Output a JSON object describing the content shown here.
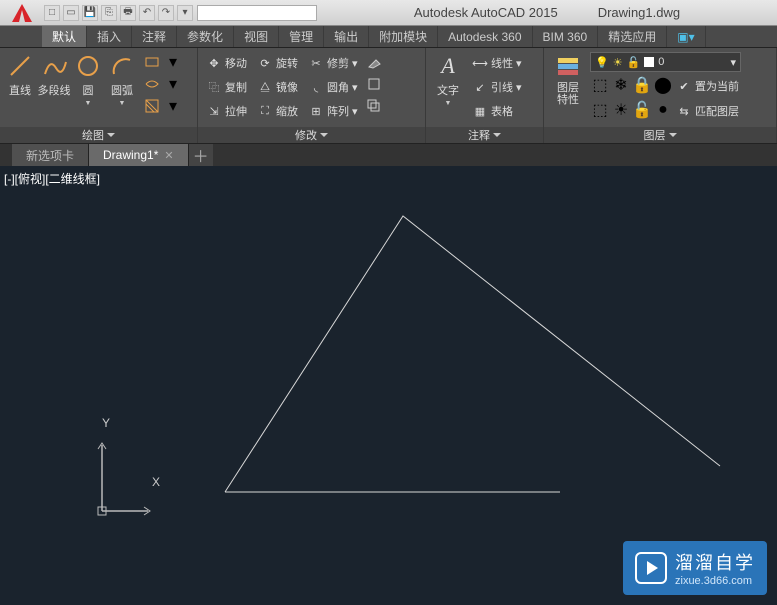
{
  "app": {
    "name": "Autodesk AutoCAD 2015",
    "doc": "Drawing1.dwg"
  },
  "qat": [
    "new",
    "open",
    "save",
    "undo",
    "redo",
    "print",
    "plot"
  ],
  "menutabs": [
    {
      "label": "默认",
      "active": true
    },
    {
      "label": "插入"
    },
    {
      "label": "注释"
    },
    {
      "label": "参数化"
    },
    {
      "label": "视图"
    },
    {
      "label": "管理"
    },
    {
      "label": "输出"
    },
    {
      "label": "附加模块"
    },
    {
      "label": "Autodesk 360"
    },
    {
      "label": "BIM 360"
    },
    {
      "label": "精选应用"
    }
  ],
  "panels": {
    "draw": {
      "title": "绘图",
      "big": [
        {
          "name": "line",
          "label": "直线"
        },
        {
          "name": "polyline",
          "label": "多段线"
        },
        {
          "name": "circle",
          "label": "圆"
        },
        {
          "name": "arc",
          "label": "圆弧"
        }
      ]
    },
    "modify": {
      "title": "修改",
      "rows": [
        [
          {
            "name": "move",
            "label": "移动"
          },
          {
            "name": "rotate",
            "label": "旋转"
          },
          {
            "name": "trim",
            "label": "修剪"
          }
        ],
        [
          {
            "name": "copy",
            "label": "复制"
          },
          {
            "name": "mirror",
            "label": "镜像"
          },
          {
            "name": "fillet",
            "label": "圆角"
          }
        ],
        [
          {
            "name": "stretch",
            "label": "拉伸"
          },
          {
            "name": "scale",
            "label": "缩放"
          },
          {
            "name": "array",
            "label": "阵列"
          }
        ]
      ]
    },
    "annotate": {
      "title": "注释",
      "big": {
        "name": "text",
        "label": "文字"
      },
      "rows": [
        {
          "name": "linear",
          "label": "线性"
        },
        {
          "name": "leader",
          "label": "引线"
        },
        {
          "name": "table",
          "label": "表格"
        }
      ]
    },
    "layers": {
      "title": "图层",
      "big": {
        "name": "layer-props",
        "label": "图层\n特性"
      },
      "combo_value": "0",
      "btns": [
        {
          "name": "make-current",
          "label": "置为当前"
        },
        {
          "name": "match-layer",
          "label": "匹配图层"
        }
      ]
    }
  },
  "doctabs": [
    {
      "label": "新选项卡",
      "active": false
    },
    {
      "label": "Drawing1*",
      "active": true
    }
  ],
  "view_control": "[-][俯视][二维线框]",
  "ucs": {
    "x": "X",
    "y": "Y"
  },
  "watermark": {
    "text": "溜溜自学",
    "url": "zixue.3d66.com"
  }
}
